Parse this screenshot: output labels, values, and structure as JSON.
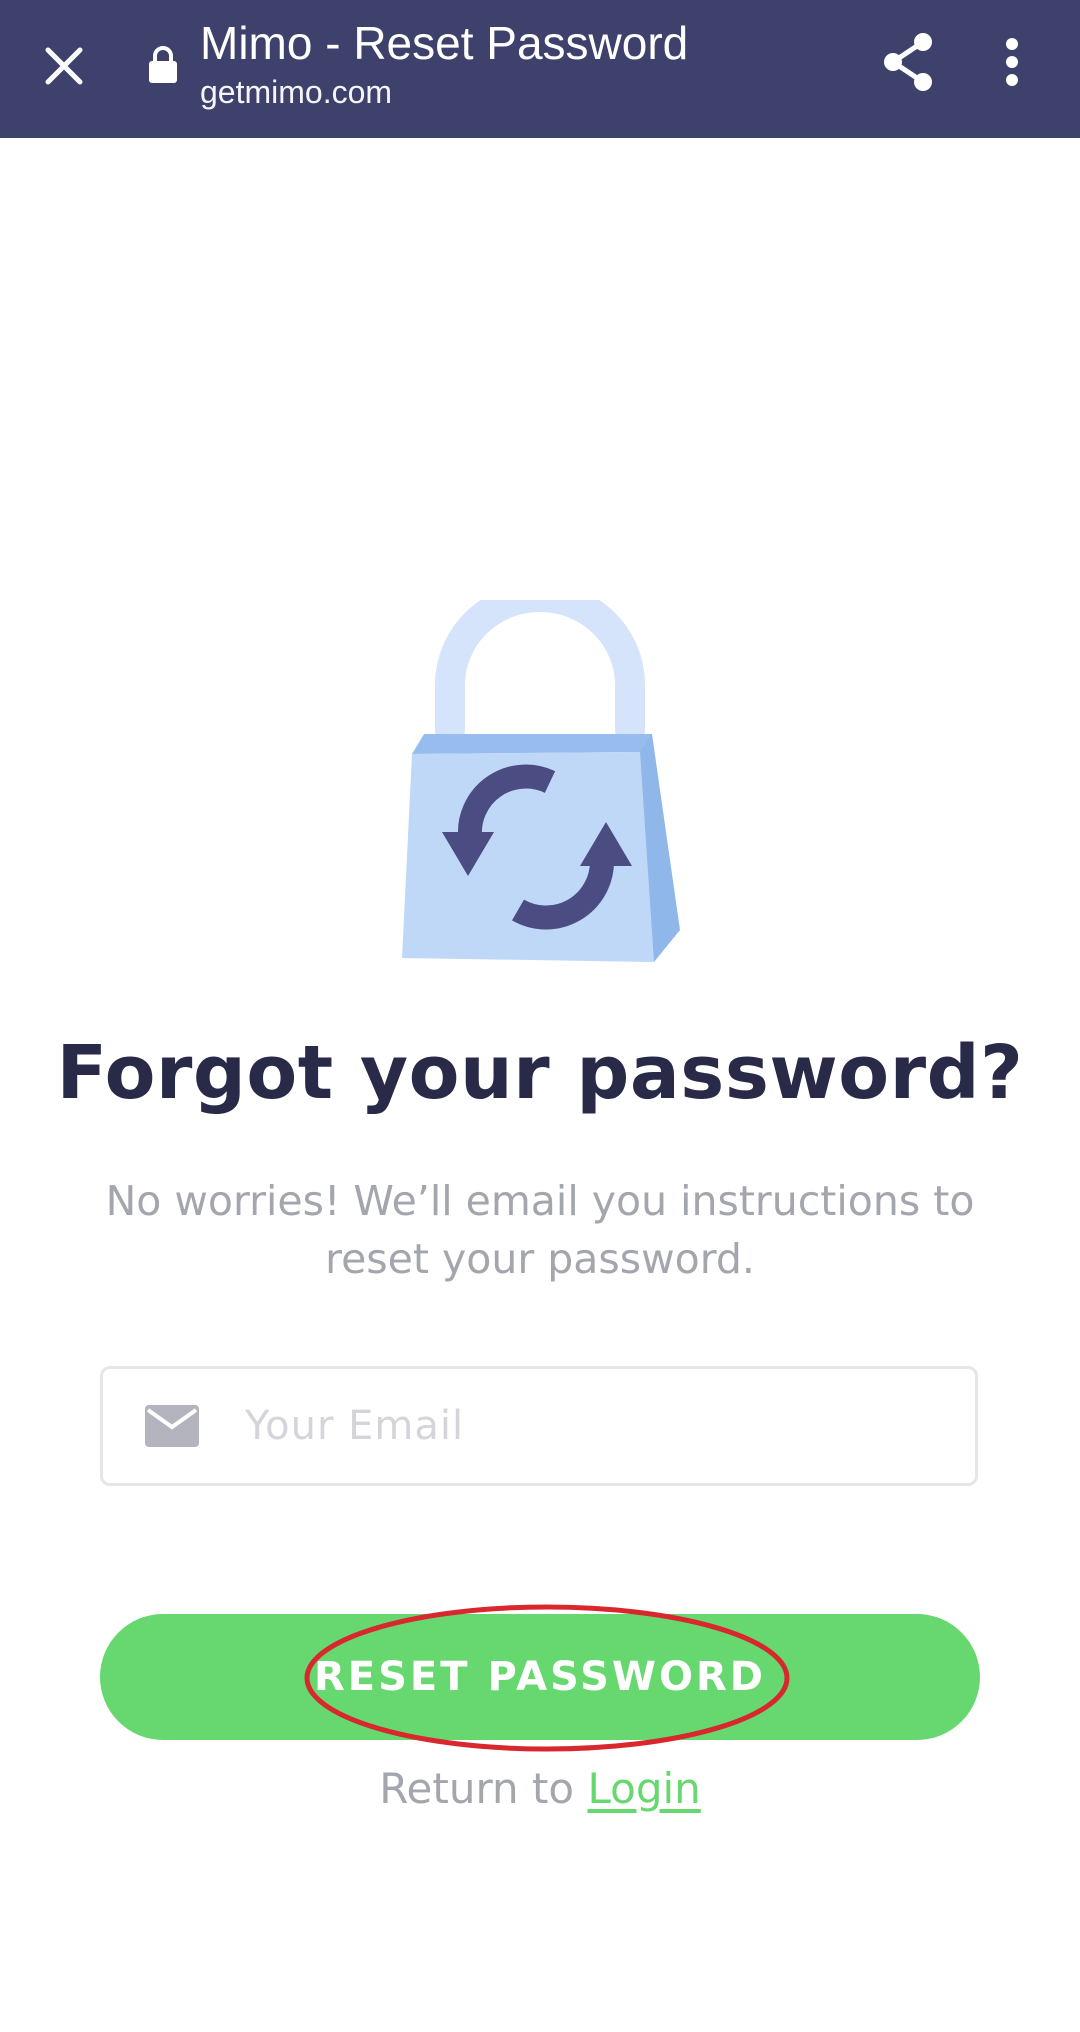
{
  "browser": {
    "title": "Mimo - Reset Password",
    "url": "getmimo.com",
    "color": "#3f416d",
    "icons": [
      "close-icon",
      "lock-icon",
      "share-icon",
      "more-vertical-icon"
    ]
  },
  "hero": {
    "icon": "padlock-refresh-illustration"
  },
  "main": {
    "heading": "Forgot your password?",
    "description": "No worries! We’ll email you instructions to reset your password.",
    "email_placeholder": "Your Email",
    "email_value": "",
    "email_icon": "mail-icon",
    "reset_button_label": "RESET PASSWORD",
    "return_text": "Return to ",
    "login_link_label": "Login"
  },
  "colors": {
    "accent": "#66d86f",
    "heading": "#282a48",
    "muted": "#a4a6ae",
    "annotation": "#d9272e"
  }
}
